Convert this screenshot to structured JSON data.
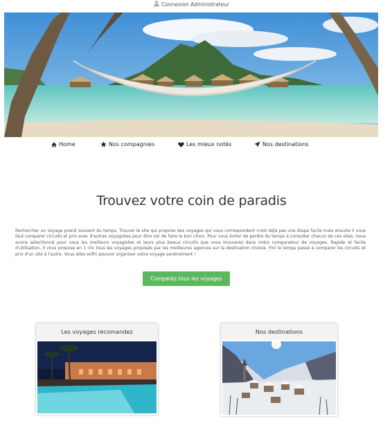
{
  "topbar": {
    "admin_login": "Connexion Administrateur",
    "admin_icon": "user-icon"
  },
  "hero": {
    "image_alt": "tropical-beach-hammock-image"
  },
  "nav": {
    "items": [
      {
        "label": "Home",
        "icon": "home-icon"
      },
      {
        "label": "Nos compagnies",
        "icon": "star-icon"
      },
      {
        "label": "Les mieux notés",
        "icon": "heart-icon"
      },
      {
        "label": "Nos destinations",
        "icon": "paper-plane-icon"
      }
    ]
  },
  "main": {
    "headline": "Trouvez votre coin de paradis",
    "intro": "Rechercher un voyage prend souvent du temps. Trouver le site qui propose des voyages qui vous correspondent n'est déjà pas une étape facile mais ensuite il vous faut comparer circuits et prix avec d'autres voyagistes pour être sûr de faire le bon choix. Pour vous éviter de perdre du temps à consulter chacun de ces sites, nous avons sélectionné pour vous les meilleurs voyagistes et leurs plus beaux circuits que vous trouverez dans notre comparateur de voyages. Rapide et facile d'utilisation, il vous propose en 1 clic tous les voyages proposés par les meilleures agences sur la destination choisie. Fini le temps passé à comparer les circuits et prix d'un site à l'autre. Vous allez enfin pouvoir organiser votre voyage sereinement !",
    "cta_label": "Comparez tous les voyages",
    "cta_color": "#5cb85c"
  },
  "cards": [
    {
      "title": "Les voyages recomandez",
      "image": "resort-pool-night-image"
    },
    {
      "title": "Nos destinations",
      "image": "snowy-mountain-village-image"
    }
  ]
}
